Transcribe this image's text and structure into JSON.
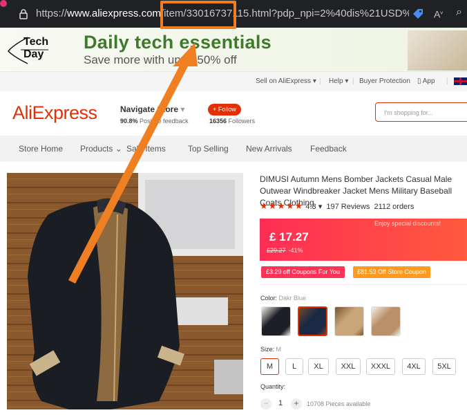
{
  "browser": {
    "url_prefix": "https://",
    "url_host": "www.aliexpress.com",
    "url_path": "/item/33016737115.html?pdp_npi=2%40dis%21USD%2134.93...",
    "lock_icon": "lock-icon",
    "tag_icon": "tag-icon",
    "read_icon": "read-aloud-icon",
    "zoom_icon": "zoom-icon"
  },
  "banner": {
    "logo_line1": "Tech",
    "logo_line2": "Day",
    "title": "Daily tech essentials",
    "subtitle": "Save more with up to 50% off"
  },
  "top_links": {
    "sell": "Sell on AliExpress",
    "help": "Help",
    "buyer_protection": "Buyer Protection",
    "app": "App"
  },
  "store": {
    "logo": "AliExpress",
    "name": "Navigate Store",
    "feedback_pct": "90.8%",
    "feedback_text": "Positive feedback",
    "follow": "+ Follow",
    "followers_count": "16356",
    "followers_text": "Followers",
    "search_placeholder": "I'm shopping for..."
  },
  "nav": {
    "items": [
      "Store Home",
      "Products",
      "Sale Items",
      "Top Selling",
      "New Arrivals",
      "Feedback"
    ]
  },
  "product": {
    "title": "DIMUSI Autumn Mens Bomber Jackets Casual Male Outwear Windbreaker Jacket Mens Military Baseball Coats Clothing",
    "rating": "4.3",
    "reviews": "197 Reviews",
    "orders": "2112 orders",
    "enjoy": "Enjoy special discounts!",
    "price": "£ 17.27",
    "old_price": "£29.27",
    "discount": "-41%",
    "coupon1": "£3.29 off Coupons For You",
    "coupon2": "£81.53 Off Store Coupon",
    "color_label": "Color:",
    "color_value": "Dakr Blue",
    "size_label": "Size:",
    "size_value": "M",
    "sizes": [
      "M",
      "L",
      "XL",
      "XXL",
      "XXXL",
      "4XL",
      "5XL"
    ],
    "qty_label": "Quantity:",
    "qty": "1",
    "available": "10708 Pieces available"
  },
  "colors": {
    "accent": "#e62e04",
    "annotation": "#f07f22"
  }
}
